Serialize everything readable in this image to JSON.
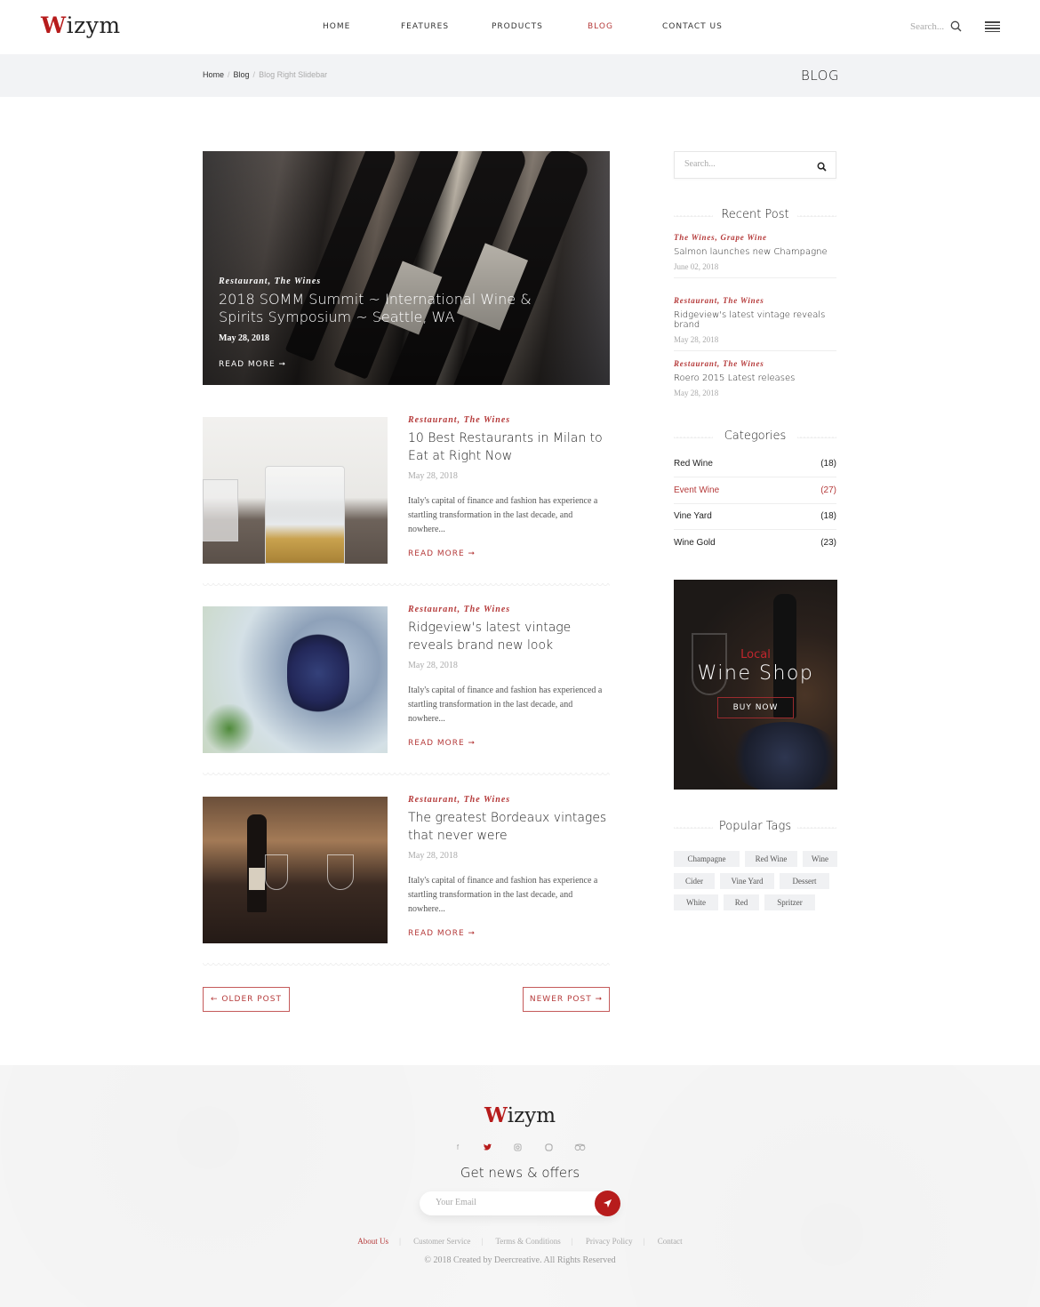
{
  "header": {
    "logo_initial": "W",
    "logo_rest": "izym",
    "nav": [
      {
        "label": "HOME",
        "active": false
      },
      {
        "label": "FEATURES",
        "active": false
      },
      {
        "label": "PRODUCTS",
        "active": false
      },
      {
        "label": "BLOG",
        "active": true
      },
      {
        "label": "CONTACT US",
        "active": false
      }
    ],
    "search_placeholder": "Search...",
    "icons": {
      "search": "search-icon",
      "menu": "hamburger-menu-icon"
    }
  },
  "breadcrumb": {
    "items": [
      "Home",
      "Blog"
    ],
    "separator": "/",
    "current": "Blog Right Slidebar",
    "page_title": "BLOG"
  },
  "featured_post": {
    "categories": "Restaurant, The Wines",
    "title": "2018 SOMM Summit ~ International Wine & Spirits Symposium ~ Seattle, WA",
    "date": "May 28, 2018",
    "read_more": "READ MORE ➞"
  },
  "posts": [
    {
      "categories": "Restaurant, The Wines",
      "title": "10 Best Restaurants in Milan to Eat at Right Now",
      "date": "May 28, 2018",
      "excerpt": "Italy's capital of finance and fashion has experience a startling transformation in the last decade, and nowhere...",
      "read_more": "READ MORE ➞"
    },
    {
      "categories": "Restaurant, The Wines",
      "title": "Ridgeview's latest vintage reveals brand new look",
      "date": "May 28, 2018",
      "excerpt": "Italy's capital of finance and fashion has experienced a startling transformation in the last decade, and nowhere...",
      "read_more": "READ MORE ➞"
    },
    {
      "categories": "Restaurant, The Wines",
      "title": "The greatest Bordeaux vintages that never were",
      "date": "May 28, 2018",
      "excerpt": "Italy's capital of finance and fashion has experience a startling transformation in the last decade, and nowhere...",
      "read_more": "READ MORE ➞"
    }
  ],
  "pagination": {
    "older": "← OLDER POST",
    "newer": "NEWER POST ➞"
  },
  "sidebar": {
    "search_placeholder": "Search...",
    "recent_heading": "Recent Post",
    "recent_posts": [
      {
        "categories": "The Wines, Grape Wine",
        "title": "Salmon launches new Champagne",
        "date": "June 02, 2018"
      },
      {
        "categories": "Restaurant, The Wines",
        "title": "Ridgeview's latest vintage reveals brand",
        "date": "May 28, 2018"
      },
      {
        "categories": "Restaurant, The Wines",
        "title": "Roero 2015 Latest releases",
        "date": "May 28, 2018"
      }
    ],
    "categories_heading": "Categories",
    "categories": [
      {
        "name": "Red Wine",
        "count": "(18)",
        "active": false
      },
      {
        "name": "Event Wine",
        "count": "(27)",
        "active": true
      },
      {
        "name": "Vine Yard",
        "count": "(18)",
        "active": false
      },
      {
        "name": "Wine Gold",
        "count": "(23)",
        "active": false
      }
    ],
    "ad": {
      "eyebrow": "Local",
      "title": "Wine Shop",
      "button": "BUY NOW"
    },
    "tags_heading": "Popular Tags",
    "tags": [
      "Champagne",
      "Red Wine",
      "Wine",
      "Cider",
      "Vine Yard",
      "Dessert",
      "White",
      "Red",
      "Spritzer"
    ]
  },
  "footer": {
    "logo_initial": "W",
    "logo_rest": "izym",
    "social": [
      "facebook-icon",
      "twitter-icon",
      "instagram-icon",
      "skype-icon",
      "tripadvisor-icon"
    ],
    "newsletter_heading": "Get news & offers",
    "email_placeholder": "Your Email",
    "links": [
      "About Us",
      "Customer Service",
      "Terms & Conditions",
      "Privacy Policy",
      "Contact"
    ],
    "copyright": "© 2018 Created by Deercreative. All Rights Reserved"
  },
  "colors": {
    "accent": "#b53a3a",
    "brand_red": "#b71c1c",
    "crumb_bg": "#f2f3f5",
    "footer_bg": "#f6f6f6"
  }
}
